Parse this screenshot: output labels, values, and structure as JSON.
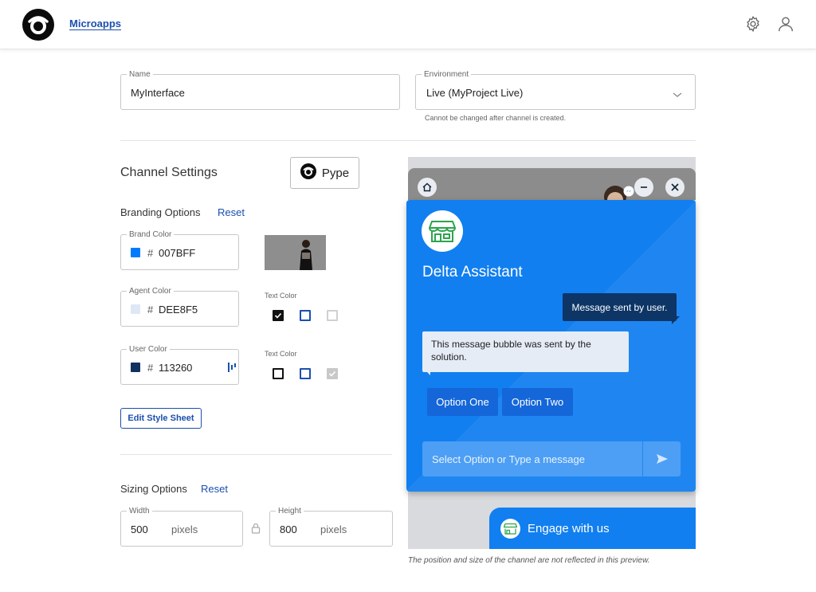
{
  "header": {
    "app_link": "Microapps"
  },
  "form": {
    "name_label": "Name",
    "name_value": "MyInterface",
    "env_label": "Environment",
    "env_value": "Live (MyProject Live)",
    "env_hint": "Cannot be changed after channel is created."
  },
  "channel": {
    "title": "Channel Settings",
    "pype_button": "Pype"
  },
  "branding": {
    "title": "Branding Options",
    "reset": "Reset",
    "brand_color_label": "Brand Color",
    "brand_color_hash": "#",
    "brand_color_value": "007BFF",
    "agent_color_label": "Agent Color",
    "agent_color_hash": "#",
    "agent_color_value": "DEE8F5",
    "user_color_label": "User Color",
    "user_color_hash": "#",
    "user_color_value": "113260",
    "text_color_label_1": "Text Color",
    "text_color_label_2": "Text Color",
    "edit_stylesheet": "Edit Style Sheet"
  },
  "sizing": {
    "title": "Sizing Options",
    "reset": "Reset",
    "width_label": "Width",
    "width_value": "500",
    "width_unit": "pixels",
    "height_label": "Height",
    "height_value": "800",
    "height_unit": "pixels"
  },
  "preview": {
    "assistant_name": "Delta Assistant",
    "user_message": "Message sent by user.",
    "bot_message": "This message bubble was sent by the solution.",
    "option_one": "Option One",
    "option_two": "Option Two",
    "input_placeholder": "Select Option or Type a message",
    "engage_label": "Engage with us",
    "note": "The position and size of the channel are not reflected in this preview."
  },
  "colors": {
    "brand": "#007BFF",
    "agent": "#DEE8F5",
    "user": "#113260",
    "link": "#1b4fae"
  },
  "icons": {
    "logo": "pype-logo-icon",
    "settings": "gear-icon",
    "account": "user-icon",
    "env_dropdown": "chevron-down-icon",
    "lock": "lock-icon",
    "home": "home-icon",
    "minimize": "minimize-icon",
    "close": "close-icon",
    "store": "store-icon",
    "send": "send-icon",
    "messenger": "messenger-icon"
  }
}
